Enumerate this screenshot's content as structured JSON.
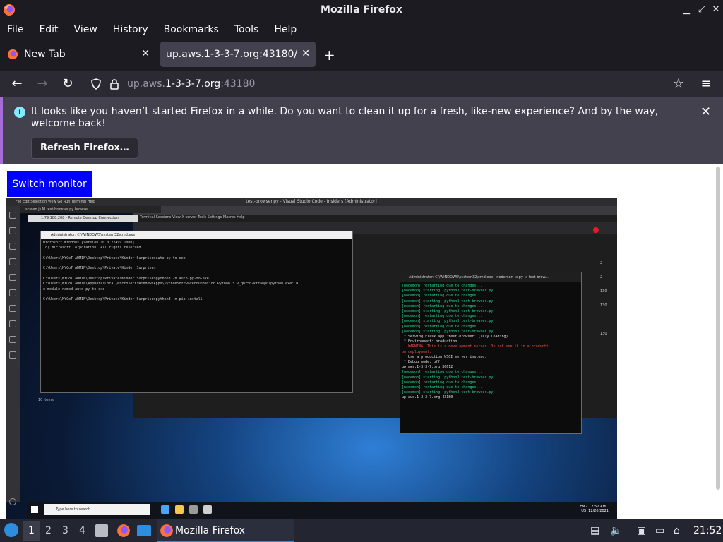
{
  "window": {
    "title": "Mozilla Firefox"
  },
  "menu": [
    "File",
    "Edit",
    "View",
    "History",
    "Bookmarks",
    "Tools",
    "Help"
  ],
  "tabs": [
    {
      "label": "New Tab",
      "active": false
    },
    {
      "label": "up.aws.1-3-3-7.org:43180/",
      "active": true
    }
  ],
  "urlbar": {
    "prefix": "up.aws.",
    "host": "1-3-3-7.org",
    "suffix": ":43180"
  },
  "notification": {
    "message": "It looks like you haven’t started Firefox in a while. Do you want to clean it up for a fresh, like-new experience? And by the way, welcome back!",
    "button": "Refresh Firefox…"
  },
  "page": {
    "switch_button": "Switch monitor"
  },
  "remote": {
    "vsc_title": "test-browser.py - Visual Studio Code - Insiders [Administrator]",
    "vsc_menu": "File   Edit   Selection   View   Go   Run   Terminal   Help",
    "vsc_tabs": "screen.js M      test-browser.py      browse",
    "rdc_title": "1.79.188.208 - Remote Desktop Connection",
    "bg_top": "BABGY 2.0",
    "bg_menu": "Terminal   Sessions   View   X server   Tools   Settings   Macros   Help",
    "side_nums": [
      "2",
      "2",
      "130",
      "130",
      "130"
    ],
    "items_count": "10 items",
    "cmd_title": "Administrator: C:\\WINDOWS\\system32\\cmd.exe",
    "cmd_lines": [
      "Microsoft Windows [Version 10.0.22499.1000]",
      "(c) Microsoft Corporation. All rights reserved.",
      "",
      "C:\\Users\\MYCoT ADMIN\\Desktop\\Private\\Kinder Surprise>auto-py-to-exe",
      "",
      "C:\\Users\\MYCoT ADMIN\\Desktop\\Private\\Kinder Surprise>",
      "",
      "C:\\Users\\MYCoT ADMIN\\Desktop\\Private\\Kinder Surprise>python3 -m auto-py-to-exe",
      "C:\\Users\\MYCoT ADMIN\\AppData\\Local\\Microsoft\\WindowsApps\\PythonSoftwareFoundation.Python.3.9_qbz5n2kfra8p0\\python.exe: N",
      "o module named auto-py-to-exe",
      "",
      "C:\\Users\\MYCoT ADMIN\\Desktop\\Private\\Kinder Surprise>python3 -m pip install _"
    ],
    "ps_title": "Administrator: C:\\WINDOWS\\system32\\cmd.exe - nodemon  -x py -x test-brow...",
    "ps_lines": [
      {
        "t": "[nodemon] restarting due to changes...",
        "c": "g"
      },
      {
        "t": "[nodemon] starting `python3 test-browser.py`",
        "c": "g"
      },
      {
        "t": "[nodemon] restarting due to changes...",
        "c": "g"
      },
      {
        "t": "[nodemon] starting `python3 test-browser.py`",
        "c": "g"
      },
      {
        "t": "[nodemon] restarting due to changes...",
        "c": "g"
      },
      {
        "t": "[nodemon] starting `python3 test-browser.py`",
        "c": "g"
      },
      {
        "t": "[nodemon] restarting due to changes...",
        "c": "g"
      },
      {
        "t": "[nodemon] starting `python3 test-browser.py`",
        "c": "g"
      },
      {
        "t": "[nodemon] restarting due to changes...",
        "c": "g"
      },
      {
        "t": "[nodemon] starting `python3 test-browser.py`",
        "c": "g"
      },
      {
        "t": " * Serving Flask app 'test-browser' (lazy loading)",
        "c": "w"
      },
      {
        "t": " * Environment: production",
        "c": "w"
      },
      {
        "t": "   WARNING: This is a development server. Do not use it in a producti",
        "c": "r"
      },
      {
        "t": "on deployment.",
        "c": "r"
      },
      {
        "t": "   Use a production WSGI server instead.",
        "c": "w"
      },
      {
        "t": " * Debug mode: off",
        "c": "w"
      },
      {
        "t": "up.aws.1-3-3-7.org:36612",
        "c": "w"
      },
      {
        "t": "[nodemon] restarting due to changes...",
        "c": "g"
      },
      {
        "t": "[nodemon] starting `python3 test-browser.py`",
        "c": "g"
      },
      {
        "t": "[nodemon] restarting due to changes...",
        "c": "g"
      },
      {
        "t": "[nodemon] restarting due to changes...",
        "c": "g"
      },
      {
        "t": "[nodemon] starting `python3 test-browser.py`",
        "c": "g"
      },
      {
        "t": "up.aws.1-3-3-7.org:43180",
        "c": "w"
      }
    ],
    "win_search": "Type here to search",
    "win_lang": [
      "ENG",
      "US"
    ],
    "win_time": [
      "2:52 AM",
      "12/20/2021"
    ]
  },
  "panel": {
    "workspaces": [
      "1",
      "2",
      "3",
      "4"
    ],
    "task_label": "Mozilla Firefox",
    "clock": "21:52"
  },
  "colors": {
    "chrome_bg": "#1c1b22",
    "nav_bg": "#2b2a33",
    "notif_bg": "#42414d",
    "switch_button_bg": "#0000ff"
  }
}
